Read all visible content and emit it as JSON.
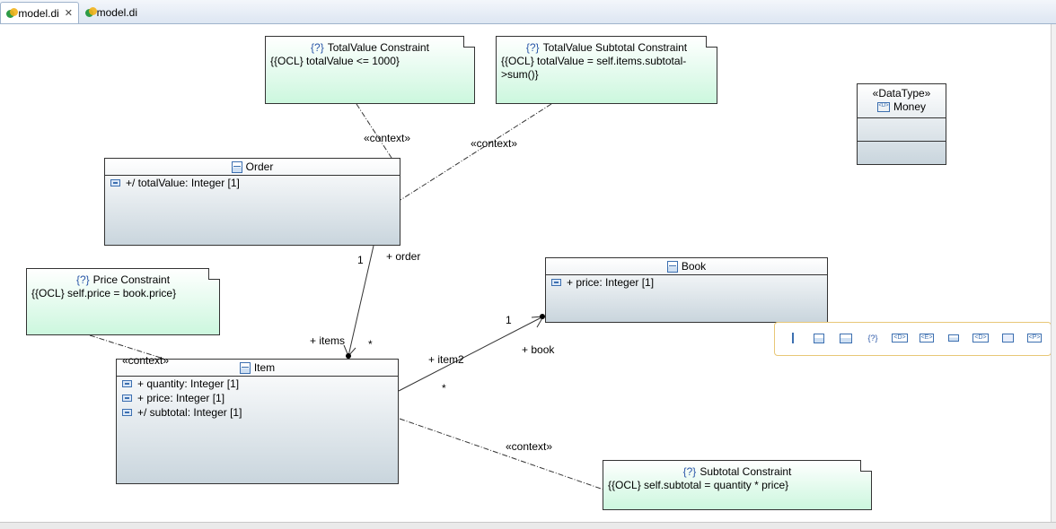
{
  "tabs": [
    {
      "label": "model.di",
      "active": true,
      "closable": true,
      "icon": "papyrus-model-icon"
    },
    {
      "label": "model.di",
      "active": false,
      "icon": "papyrus-model-icon"
    }
  ],
  "notes": {
    "total_value": {
      "marker": "{?}",
      "title": "TotalValue Constraint",
      "body": [
        "{{OCL} totalValue <= 1000}"
      ]
    },
    "total_value_subtotal": {
      "marker": "{?}",
      "title": "TotalValue Subtotal Constraint",
      "body": [
        "{{OCL} totalValue = self.items.subtotal-",
        ">sum()}"
      ]
    },
    "price": {
      "marker": "{?}",
      "title": "Price Constraint",
      "body": [
        "{{OCL} self.price = book.price}"
      ]
    },
    "subtotal": {
      "marker": "{?}",
      "title": "Subtotal Constraint",
      "body": [
        "{{OCL} self.subtotal = quantity * price}"
      ]
    }
  },
  "classes": {
    "order": {
      "name": "Order",
      "attributes": [
        "+/ totalValue: Integer [1]"
      ]
    },
    "book": {
      "name": "Book",
      "attributes": [
        "+ price: Integer [1]"
      ]
    },
    "item": {
      "name": "Item",
      "attributes": [
        "+ quantity: Integer [1]",
        "+ price: Integer [1]",
        "+/ subtotal: Integer [1]"
      ]
    }
  },
  "datatype": {
    "stereotype": "«DataType»",
    "icon_text": "<D>",
    "name": "Money"
  },
  "labels": {
    "context_order": "«context»",
    "context_subtotal_link": "«context»",
    "context_item": "«context»",
    "context_subtotal": "«context»",
    "order_mult": "1",
    "order_role": "+ order",
    "items_role": "+ items",
    "items_mult": "*",
    "book_mult": "1",
    "item2_role": "+ item2",
    "item2_mult": "*",
    "book_role": "+ book"
  },
  "palette": [
    {
      "icon": "property-icon",
      "text": ""
    },
    {
      "icon": "class-icon",
      "text": ""
    },
    {
      "icon": "component-icon",
      "text": ""
    },
    {
      "icon": "constraint-icon",
      "text": "{?}"
    },
    {
      "icon": "datatype-icon",
      "text": "<D>"
    },
    {
      "icon": "enumeration-icon",
      "text": "<E>"
    },
    {
      "icon": "primitive-icon",
      "text": ""
    },
    {
      "icon": "interface-icon",
      "text": "<D>"
    },
    {
      "icon": "package-icon",
      "text": ""
    },
    {
      "icon": "primitivetype-icon",
      "text": "<P>"
    }
  ],
  "colors": {
    "note_fill": "#ccf7de",
    "class_fill": "#c9d5dd",
    "accent": "#2b57a8",
    "palette_border": "#e8c777"
  }
}
